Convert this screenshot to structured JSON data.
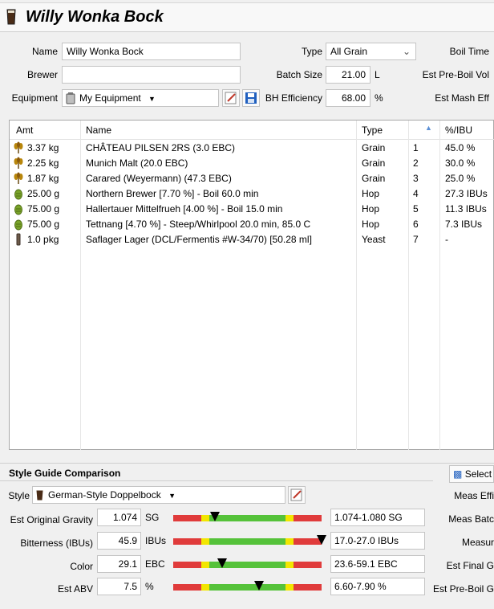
{
  "recipe": {
    "title": "Willy Wonka Bock"
  },
  "form": {
    "name_label": "Name",
    "name_value": "Willy Wonka Bock",
    "brewer_label": "Brewer",
    "brewer_value": "",
    "equipment_label": "Equipment",
    "equipment_value": "My Equipment",
    "type_label": "Type",
    "type_value": "All Grain",
    "batch_size_label": "Batch Size",
    "batch_size_value": "21.00",
    "batch_size_unit": "L",
    "efficiency_label": "BH Efficiency",
    "efficiency_value": "68.00",
    "efficiency_unit": "%",
    "boil_time_label": "Boil Time",
    "pre_boil_label": "Est Pre-Boil Vol",
    "mash_eff_label": "Est Mash Eff"
  },
  "table": {
    "headers": {
      "amt": "Amt",
      "name": "Name",
      "type": "Type",
      "order": "",
      "ibu": "%/IBU"
    },
    "rows": [
      {
        "icon": "grain-icon",
        "amt": "3.37 kg",
        "name": "CHÂTEAU PILSEN 2RS (3.0 EBC)",
        "type": "Grain",
        "order": "1",
        "ibu": "45.0 %"
      },
      {
        "icon": "grain-icon",
        "amt": "2.25 kg",
        "name": "Munich Malt (20.0 EBC)",
        "type": "Grain",
        "order": "2",
        "ibu": "30.0 %"
      },
      {
        "icon": "grain-icon",
        "amt": "1.87 kg",
        "name": "Carared (Weyermann) (47.3 EBC)",
        "type": "Grain",
        "order": "3",
        "ibu": "25.0 %"
      },
      {
        "icon": "hop-icon",
        "amt": "25.00 g",
        "name": "Northern Brewer [7.70 %] - Boil 60.0 min",
        "type": "Hop",
        "order": "4",
        "ibu": "27.3 IBUs"
      },
      {
        "icon": "hop-icon",
        "amt": "75.00 g",
        "name": "Hallertauer Mittelfrueh [4.00 %] - Boil 15.0 min",
        "type": "Hop",
        "order": "5",
        "ibu": "11.3 IBUs"
      },
      {
        "icon": "hop-icon",
        "amt": "75.00 g",
        "name": "Tettnang [4.70 %] - Steep/Whirlpool  20.0 min, 85.0 C",
        "type": "Hop",
        "order": "6",
        "ibu": "7.3 IBUs"
      },
      {
        "icon": "yeast-icon",
        "amt": "1.0 pkg",
        "name": "Saflager Lager (DCL/Fermentis #W-34/70) [50.28 ml]",
        "type": "Yeast",
        "order": "7",
        "ibu": "-"
      }
    ]
  },
  "style_guide": {
    "heading": "Style Guide Comparison",
    "style_label": "Style",
    "style_value": "German-Style Doppelbock",
    "select_label": "Select",
    "metrics": [
      {
        "label": "Est Original Gravity",
        "value": "1.074",
        "unit": "SG",
        "range": "1.074-1.080 SG",
        "marker": 0.28
      },
      {
        "label": "Bitterness (IBUs)",
        "value": "45.9",
        "unit": "IBUs",
        "range": "17.0-27.0 IBUs",
        "marker": 1.0
      },
      {
        "label": "Color",
        "value": "29.1",
        "unit": "EBC",
        "range": "23.6-59.1 EBC",
        "marker": 0.33
      },
      {
        "label": "Est ABV",
        "value": "7.5",
        "unit": "%",
        "range": "6.60-7.90 %",
        "marker": 0.58
      }
    ],
    "right_labels": [
      "Meas Effi",
      "Meas Batc",
      "Measur",
      "Est Final G",
      "Est Pre-Boil G"
    ]
  }
}
